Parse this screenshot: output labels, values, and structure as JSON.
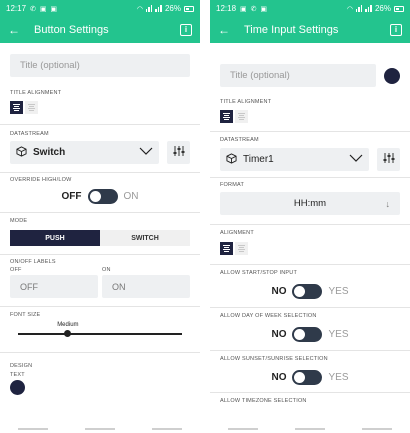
{
  "left": {
    "status": {
      "time": "12:17",
      "battery": "26%"
    },
    "appbar": {
      "title": "Button Settings",
      "info": "i"
    },
    "title_placeholder": "Title (optional)",
    "title_alignment_label": "TITLE ALIGNMENT",
    "datastream_label": "DATASTREAM",
    "datastream_value": "Switch",
    "override_label": "OVERRIDE HIGH/LOW",
    "override": {
      "off": "OFF",
      "on": "ON"
    },
    "mode_label": "MODE",
    "mode_options": [
      "PUSH",
      "SWITCH"
    ],
    "onoff_label": "ON/OFF LABELS",
    "off_label": "OFF",
    "on_label": "ON",
    "off_value": "OFF",
    "on_value": "ON",
    "font_size_label": "FONT SIZE",
    "font_size_value": "Medium",
    "font_size_level": 0.3,
    "design_label": "DESIGN",
    "text_label": "TEXT",
    "text_color": "#1f2340"
  },
  "right": {
    "status": {
      "time": "12:18",
      "battery": "26%"
    },
    "appbar": {
      "title": "Time Input Settings",
      "info": "i"
    },
    "title_placeholder": "Title (optional)",
    "title_alignment_label": "TITLE ALIGNMENT",
    "datastream_label": "DATASTREAM",
    "datastream_value": "Timer1",
    "format_label": "FORMAT",
    "format_value": "HH:mm",
    "alignment_label": "ALIGNMENT",
    "allow_start_stop_label": "ALLOW START/STOP INPUT",
    "allow_day_label": "ALLOW DAY OF WEEK SELECTION",
    "allow_sunset_label": "ALLOW SUNSET/SUNRISE SELECTION",
    "allow_timezone_label": "ALLOW TIMEZONE SELECTION",
    "toggle": {
      "no": "NO",
      "yes": "YES"
    },
    "title_color": "#1f2340"
  },
  "colors": {
    "accent": "#23c48e",
    "dark": "#1f2340"
  }
}
